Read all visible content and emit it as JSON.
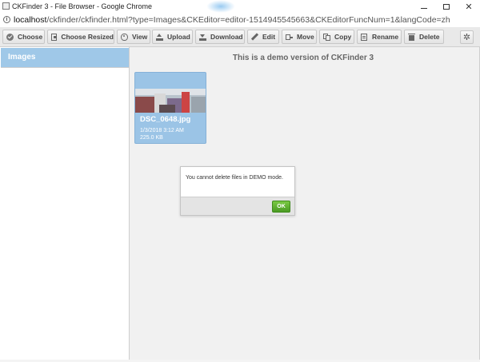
{
  "window": {
    "title": "CKFinder 3 - File Browser - Google Chrome",
    "controls": [
      "minimize",
      "maximize",
      "close"
    ]
  },
  "address": {
    "host": "localhost",
    "path": "/ckfinder/ckfinder.html?type=Images&CKEditor=editor-1514945545663&CKEditorFuncNum=1&langCode=zh"
  },
  "toolbar": {
    "buttons": [
      {
        "label": "Choose",
        "icon": "check-circle-icon"
      },
      {
        "label": "Choose Resized",
        "icon": "resize-icon"
      },
      {
        "label": "View",
        "icon": "eye-icon"
      },
      {
        "label": "Upload",
        "icon": "upload-icon"
      },
      {
        "label": "Download",
        "icon": "download-icon"
      },
      {
        "label": "Edit",
        "icon": "pencil-icon"
      },
      {
        "label": "Move",
        "icon": "move-icon"
      },
      {
        "label": "Copy",
        "icon": "copy-icon"
      },
      {
        "label": "Rename",
        "icon": "rename-icon"
      },
      {
        "label": "Delete",
        "icon": "trash-icon"
      }
    ],
    "settings_icon": "gear-icon"
  },
  "sidebar": {
    "folders": [
      {
        "label": "Images",
        "selected": true
      }
    ]
  },
  "main": {
    "demo_notice": "This is a demo version of CKFinder 3",
    "files": [
      {
        "name": "DSC_0648.jpg",
        "date": "1/3/2018 3:12 AM",
        "size": "225.0 KB",
        "selected": true
      }
    ]
  },
  "dialog": {
    "message": "You cannot delete files in DEMO mode.",
    "ok_label": "OK"
  },
  "colors": {
    "selection": "#9fc8e8",
    "ok_button": "#5aad2e",
    "toolbar_bg": "#e9e9e9",
    "main_bg": "#f1f1f1"
  }
}
